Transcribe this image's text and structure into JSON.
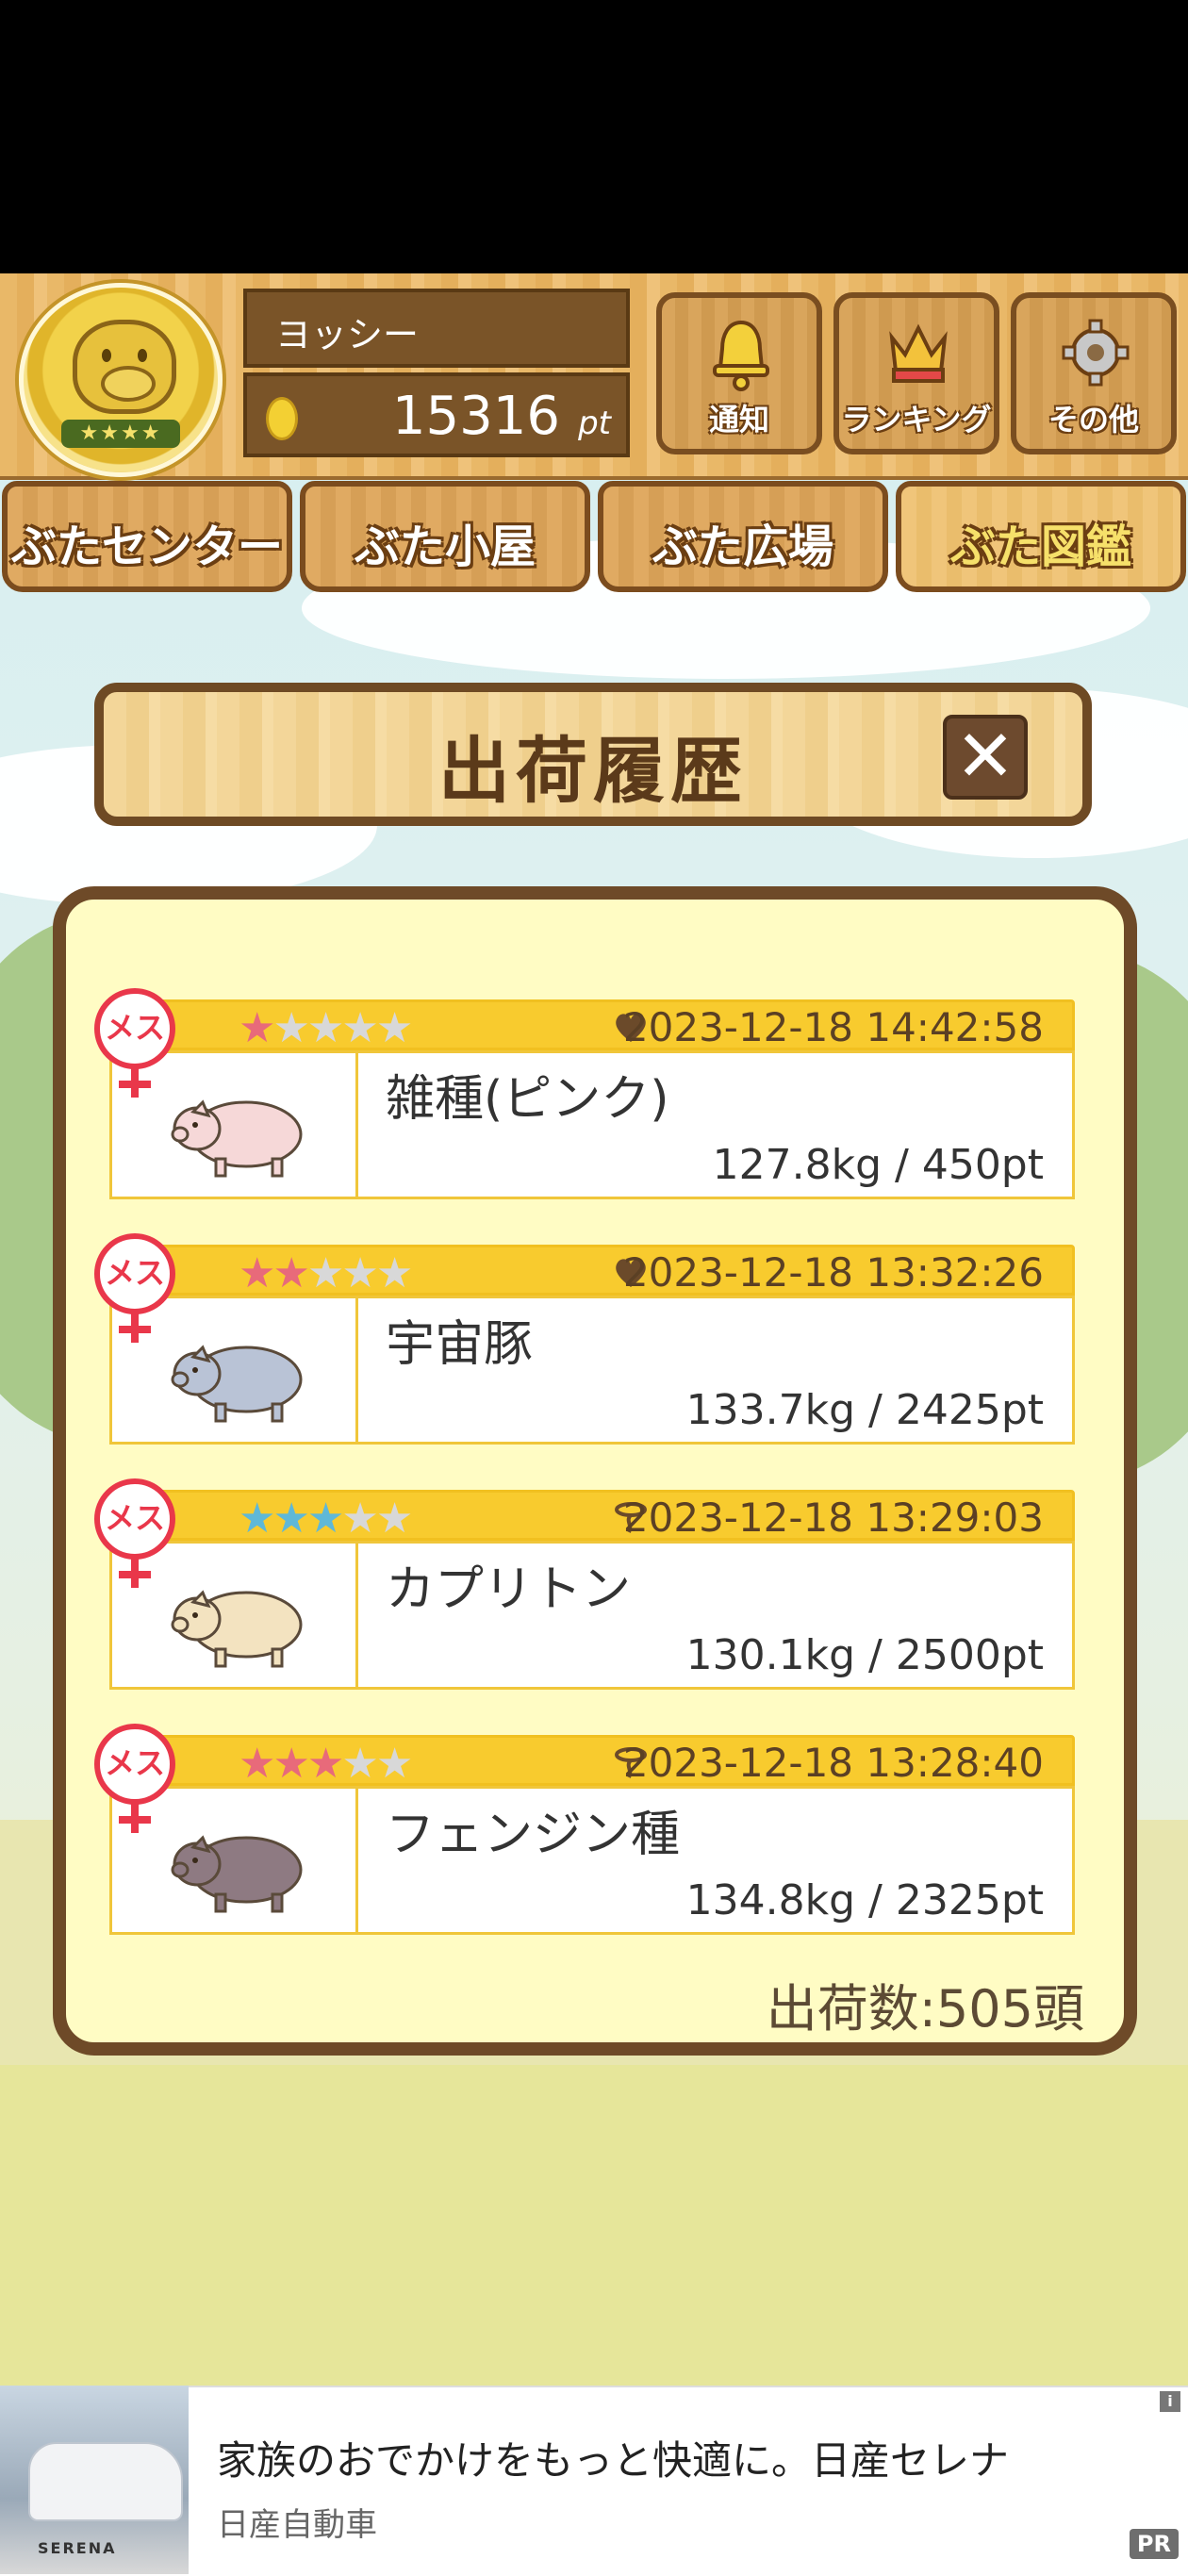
{
  "header": {
    "player_name": "ヨッシー",
    "points_value": "15316",
    "points_unit": "pt",
    "buttons": [
      {
        "label": "通知",
        "icon": "bell-icon"
      },
      {
        "label": "ランキング",
        "icon": "crown-icon"
      },
      {
        "label": "その他",
        "icon": "gear-icon"
      }
    ]
  },
  "nav": {
    "tabs": [
      "ぶたセンター",
      "ぶた小屋",
      "ぶた広場",
      "ぶた図鑑"
    ],
    "active": "ぶた図鑑"
  },
  "dialog": {
    "title": "出荷履歴",
    "close_icon": "close-icon",
    "total_label": "出荷数:505頭"
  },
  "records": [
    {
      "sex_label": "メス",
      "rank": 1,
      "star_color": "#e86a7a",
      "type_icon": "heart-icon",
      "date": "2023-12-18 14:42:58",
      "name": "雑種(ピンク)",
      "stat": "127.8kg / 450pt",
      "pig_color": "#f6d8d8"
    },
    {
      "sex_label": "メス",
      "rank": 2,
      "star_color": "#e86a7a",
      "type_icon": "heart-icon",
      "date": "2023-12-18 13:32:26",
      "name": "宇宙豚",
      "stat": "133.7kg / 2425pt",
      "pig_color": "#b9c3d6"
    },
    {
      "sex_label": "メス",
      "rank": 3,
      "star_color": "#5fb8d8",
      "type_icon": "lasso-icon",
      "date": "2023-12-18 13:29:03",
      "name": "カプリトン",
      "stat": "130.1kg / 2500pt",
      "pig_color": "#f3e3c0"
    },
    {
      "sex_label": "メス",
      "rank": 3,
      "star_color": "#e86a7a",
      "type_icon": "lasso-icon",
      "date": "2023-12-18 13:28:40",
      "name": "フェンジン種",
      "stat": "134.8kg / 2325pt",
      "pig_color": "#8e7a82"
    }
  ],
  "ad": {
    "title": "家族のおでかけをもっと快適に。日産セレナ",
    "advertiser": "日産自動車",
    "badge": "PR",
    "info": "i",
    "image_brand": "SERENA"
  },
  "colors": {
    "wood": "#e6b466",
    "panel_bg": "#fffcc4",
    "bar": "#f8cb2e",
    "female": "#e9374a"
  }
}
